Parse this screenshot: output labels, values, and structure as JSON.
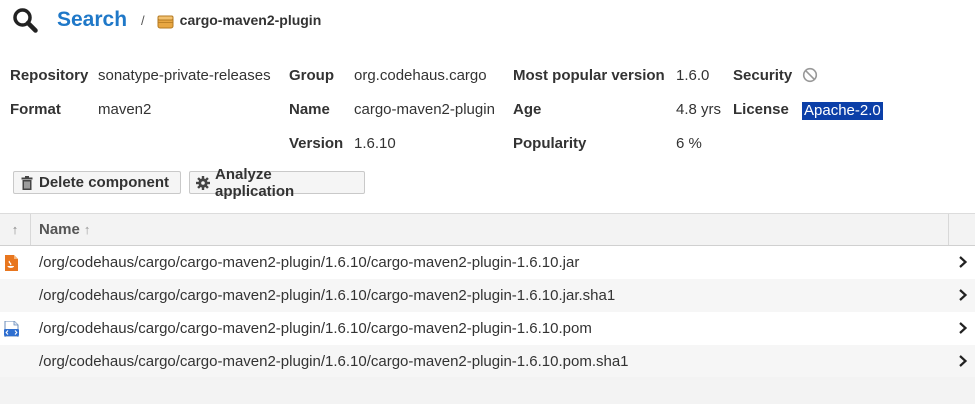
{
  "breadcrumb": {
    "search_label": "Search",
    "separator": "/",
    "current": "cargo-maven2-plugin"
  },
  "info": {
    "repository_label": "Repository",
    "repository_value": "sonatype-private-releases",
    "format_label": "Format",
    "format_value": "maven2",
    "group_label": "Group",
    "group_value": "org.codehaus.cargo",
    "name_label": "Name",
    "name_value": "cargo-maven2-plugin",
    "version_label": "Version",
    "version_value": "1.6.10",
    "most_popular_label": "Most popular version",
    "most_popular_value": "1.6.0",
    "age_label": "Age",
    "age_value": "4.8 yrs",
    "popularity_label": "Popularity",
    "popularity_value": "6 %",
    "security_label": "Security",
    "license_label": "License",
    "license_value": "Apache-2.0"
  },
  "toolbar": {
    "delete_label": "Delete component",
    "analyze_label": "Analyze application"
  },
  "grid": {
    "header_sort_icon": "↑",
    "name_header": "Name",
    "name_sort_arrow": "↑",
    "rows": [
      {
        "path": "/org/codehaus/cargo/cargo-maven2-plugin/1.6.10/cargo-maven2-plugin-1.6.10.jar",
        "icon": "jar-file-icon"
      },
      {
        "path": "/org/codehaus/cargo/cargo-maven2-plugin/1.6.10/cargo-maven2-plugin-1.6.10.jar.sha1",
        "icon": ""
      },
      {
        "path": "/org/codehaus/cargo/cargo-maven2-plugin/1.6.10/cargo-maven2-plugin-1.6.10.pom",
        "icon": "pom-file-icon"
      },
      {
        "path": "/org/codehaus/cargo/cargo-maven2-plugin/1.6.10/cargo-maven2-plugin-1.6.10.pom.sha1",
        "icon": ""
      }
    ]
  },
  "colors": {
    "link": "#1f78c8",
    "license_highlight": "#0b3fa8"
  }
}
